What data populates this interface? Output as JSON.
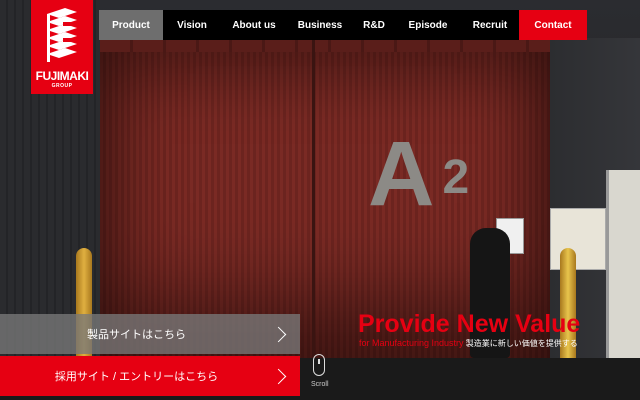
{
  "brand": {
    "name": "FUJIMAKI",
    "group": "GROUP",
    "color": "#e60012"
  },
  "nav": {
    "items": [
      {
        "label": "Product",
        "active": true
      },
      {
        "label": "Vision"
      },
      {
        "label": "About us"
      },
      {
        "label": "Business"
      },
      {
        "label": "R&D"
      },
      {
        "label": "Episode"
      },
      {
        "label": "Recruit"
      }
    ],
    "contact": "Contact"
  },
  "hero": {
    "sign": "A",
    "sign_number": "2",
    "headline": "Provide New Value",
    "sub_en": "for Manufacturing Industry",
    "sub_ja": "製造業に新しい価値を提供する"
  },
  "links": {
    "product_site": "製品サイトはこちら",
    "recruit_site": "採用サイト / エントリーはこちら"
  },
  "scroll": {
    "label": "Scroll"
  },
  "icons": [
    "chevron-right-icon",
    "scroll-mouse-icon",
    "fujimaki-logo-mark"
  ]
}
